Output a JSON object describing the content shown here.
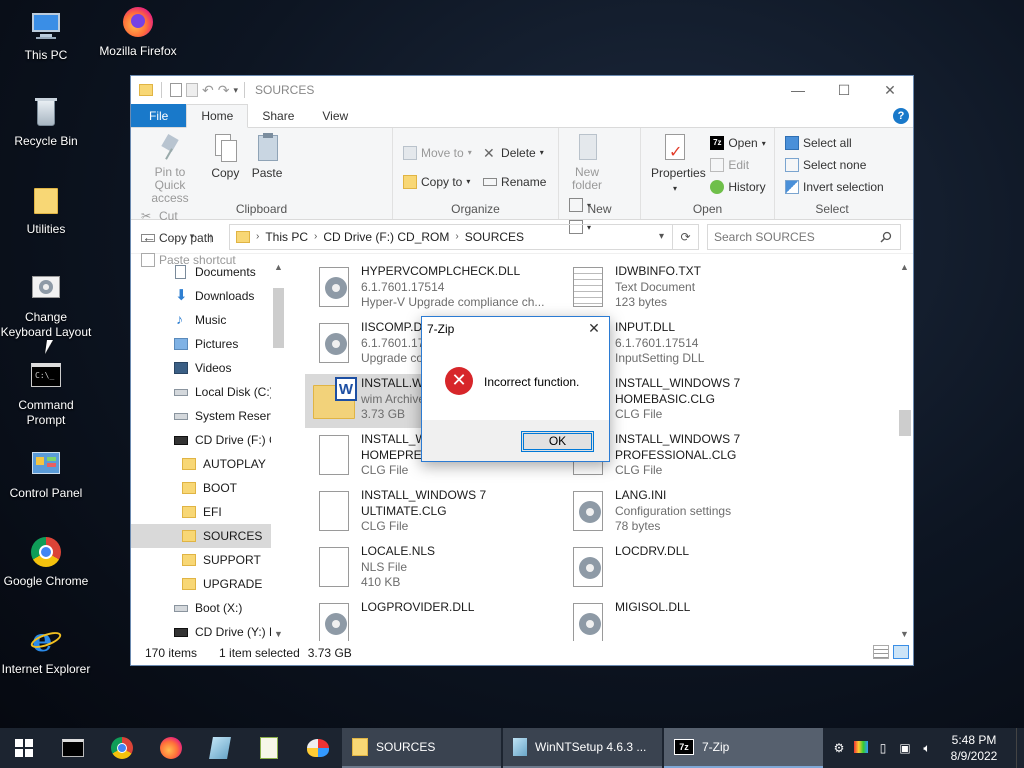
{
  "desktop": {
    "icons": [
      {
        "label": "This PC",
        "icon": "this-pc-icon"
      },
      {
        "label": "Mozilla Firefox",
        "icon": "firefox-icon"
      },
      {
        "label": "Recycle Bin",
        "icon": "recycle-bin-icon"
      },
      {
        "label": "Utilities",
        "icon": "folder-icon"
      },
      {
        "label": "Change Keyboard Layout",
        "icon": "keyboard-settings-icon"
      },
      {
        "label": "Command Prompt",
        "icon": "cmd-icon"
      },
      {
        "label": "Control Panel",
        "icon": "control-panel-icon"
      },
      {
        "label": "Google Chrome",
        "icon": "chrome-icon"
      },
      {
        "label": "Internet Explorer",
        "icon": "ie-icon"
      }
    ]
  },
  "explorer": {
    "title": "SOURCES",
    "tabs": {
      "file": "File",
      "home": "Home",
      "share": "Share",
      "view": "View"
    },
    "ribbon": {
      "clipboard": {
        "group": "Clipboard",
        "pin_line1": "Pin to Quick",
        "pin_line2": "access",
        "copy": "Copy",
        "paste": "Paste",
        "cut": "Cut",
        "copy_path": "Copy path",
        "paste_shortcut": "Paste shortcut"
      },
      "organize": {
        "group": "Organize",
        "move_to": "Move to",
        "copy_to": "Copy to",
        "delete": "Delete",
        "rename": "Rename"
      },
      "new": {
        "group": "New",
        "new_folder_line1": "New",
        "new_folder_line2": "folder"
      },
      "open": {
        "group": "Open",
        "properties": "Properties",
        "open": "Open",
        "edit": "Edit",
        "history": "History"
      },
      "select": {
        "group": "Select",
        "select_all": "Select all",
        "select_none": "Select none",
        "invert": "Invert selection"
      }
    },
    "address": {
      "crumbs": [
        "This PC",
        "CD Drive (F:) CD_ROM",
        "SOURCES"
      ],
      "search_placeholder": "Search SOURCES"
    },
    "nav": [
      {
        "label": "Documents",
        "icon": "documents-icon",
        "indent": 1
      },
      {
        "label": "Downloads",
        "icon": "downloads-icon",
        "indent": 1
      },
      {
        "label": "Music",
        "icon": "music-icon",
        "indent": 1
      },
      {
        "label": "Pictures",
        "icon": "pictures-icon",
        "indent": 1
      },
      {
        "label": "Videos",
        "icon": "videos-icon",
        "indent": 1
      },
      {
        "label": "Local Disk (C:)",
        "icon": "drive-icon",
        "indent": 1
      },
      {
        "label": "System Reserve",
        "icon": "drive-icon",
        "indent": 1
      },
      {
        "label": "CD Drive (F:) C",
        "icon": "cd-drive-icon",
        "indent": 1
      },
      {
        "label": "AUTOPLAY",
        "icon": "folder-icon",
        "indent": 2
      },
      {
        "label": "BOOT",
        "icon": "folder-icon",
        "indent": 2
      },
      {
        "label": "EFI",
        "icon": "folder-icon",
        "indent": 2
      },
      {
        "label": "SOURCES",
        "icon": "folder-icon",
        "indent": 2,
        "selected": true
      },
      {
        "label": "SUPPORT",
        "icon": "folder-icon",
        "indent": 2
      },
      {
        "label": "UPGRADE",
        "icon": "folder-icon",
        "indent": 2
      },
      {
        "label": "Boot (X:)",
        "icon": "drive-icon",
        "indent": 1
      },
      {
        "label": "CD Drive (Y:) H",
        "icon": "cd-drive-icon",
        "indent": 1
      }
    ],
    "files": [
      {
        "name": "HYPERVCOMPLCHECK.DLL",
        "line2": "6.1.7601.17514",
        "line3": "Hyper-V Upgrade compliance ch...",
        "icon": "dll-gear-icon"
      },
      {
        "name": "IDWBINFO.TXT",
        "line2": "Text Document",
        "line3": "123 bytes",
        "icon": "text-file-icon"
      },
      {
        "name": "IISCOMP.DLL",
        "line2": "6.1.7601.17514",
        "line3": "Upgrade compliance",
        "icon": "dll-gear-icon"
      },
      {
        "name": "INPUT.DLL",
        "line2": "6.1.7601.17514",
        "line3": "InputSetting DLL",
        "icon": "dll-gear-icon"
      },
      {
        "name": "INSTALL.WIM",
        "line2": "wim Archive",
        "line3": "3.73 GB",
        "icon": "wim-archive-icon",
        "selected": true
      },
      {
        "name": "INSTALL_WINDOWS 7",
        "line2": "HOMEBASIC.CLG",
        "line3": "CLG File",
        "icon": "blank-file-icon"
      },
      {
        "name": "INSTALL_WINDOWS 7",
        "line2": "HOMEPREMIUM.CLG",
        "line3": "CLG File",
        "icon": "blank-file-icon"
      },
      {
        "name": "INSTALL_WINDOWS 7",
        "line2": "PROFESSIONAL.CLG",
        "line3": "CLG File",
        "icon": "blank-file-icon"
      },
      {
        "name": "INSTALL_WINDOWS 7",
        "line2": "ULTIMATE.CLG",
        "line3": "CLG File",
        "icon": "blank-file-icon"
      },
      {
        "name": "LANG.INI",
        "line2": "Configuration settings",
        "line3": "78 bytes",
        "icon": "ini-gear-icon"
      },
      {
        "name": "LOCALE.NLS",
        "line2": "NLS File",
        "line3": "410 KB",
        "icon": "blank-file-icon"
      },
      {
        "name": "LOCDRV.DLL",
        "line2": "",
        "line3": "",
        "icon": "dll-gear-icon"
      },
      {
        "name": "LOGPROVIDER.DLL",
        "line2": "",
        "line3": "",
        "icon": "dll-gear-icon"
      },
      {
        "name": "MIGISOL.DLL",
        "line2": "",
        "line3": "",
        "icon": "dll-gear-icon"
      }
    ],
    "status": {
      "count": "170 items",
      "selected": "1 item selected",
      "size": "3.73 GB"
    }
  },
  "dialog": {
    "title": "7-Zip",
    "message": "Incorrect function.",
    "ok": "OK"
  },
  "taskbar": {
    "tasks": [
      {
        "label": "SOURCES",
        "icon": "folder-icon"
      },
      {
        "label": "WinNTSetup 4.6.3 ...",
        "icon": "winntsetup-icon"
      },
      {
        "label": "7-Zip",
        "icon": "7zip-icon",
        "active": true
      }
    ],
    "time": "5:48 PM",
    "date": "8/9/2022"
  },
  "colors": {
    "accent": "#1979ca",
    "error": "#d7262a",
    "selection": "#d9d9d9",
    "folder": "#f8d775"
  }
}
